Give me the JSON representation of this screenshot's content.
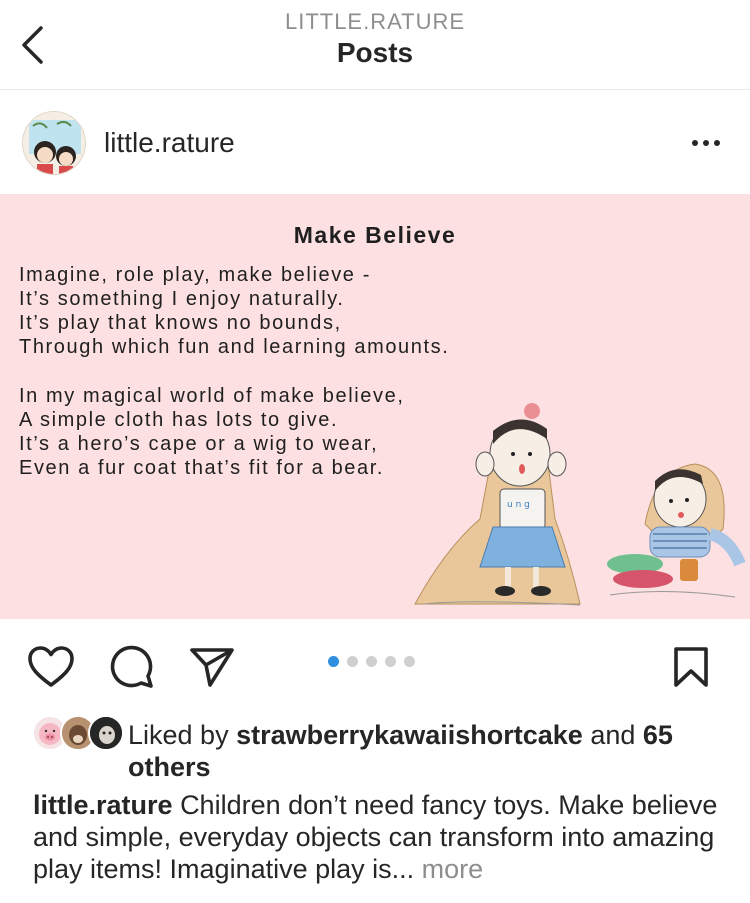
{
  "header": {
    "account": "LITTLE.RATURE",
    "title": "Posts"
  },
  "post": {
    "username": "little.rature",
    "image": {
      "title": "Make Believe",
      "stanza1": [
        "Imagine, role play, make believe -",
        "It’s something I enjoy naturally.",
        "It’s play that knows no bounds,",
        "Through which fun and learning amounts."
      ],
      "stanza2": [
        "In my magical world of make believe,",
        "A simple cloth has lots to give.",
        "It’s a hero’s cape or a wig to wear,",
        "Even a fur coat that’s fit for a bear."
      ],
      "shirt_letters": "u n g",
      "background_color": "#fde0e2"
    },
    "carousel": {
      "count": 5,
      "active_index": 0,
      "active_color": "#2f8fe0"
    },
    "likes": {
      "prefix": "Liked by",
      "user": "strawberrykawaiishortcake",
      "middle": "and",
      "count_text": "65 others"
    },
    "caption": {
      "username": "little.rature",
      "text": "Children don’t need fancy toys. Make believe and simple, everyday objects can transform into amazing play items! Imaginative play is...",
      "more_label": "more"
    }
  },
  "icons": [
    "chevron-left-icon",
    "more-horizontal-icon",
    "heart-icon",
    "comment-icon",
    "send-icon",
    "bookmark-icon"
  ]
}
